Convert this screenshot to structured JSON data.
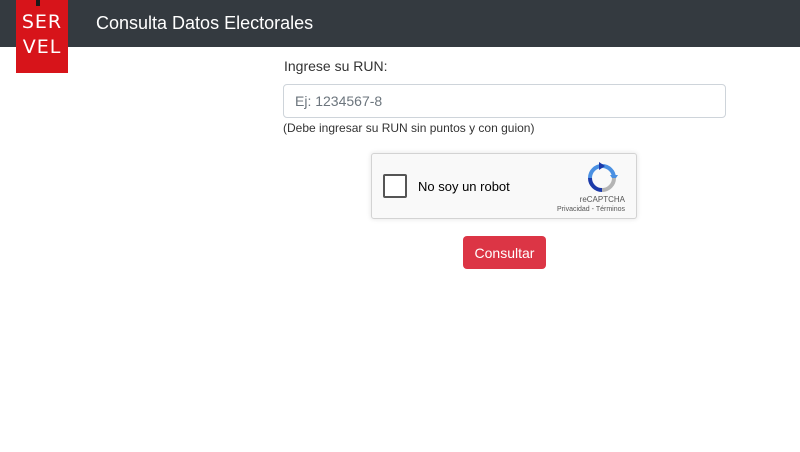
{
  "header": {
    "title": "Consulta Datos Electorales",
    "background_color": "#343a40"
  },
  "logo": {
    "line1": "SER",
    "line2": "VEL",
    "background_color": "#d7141a"
  },
  "form": {
    "run_label": "Ingrese su RUN:",
    "run_input": {
      "value": "",
      "placeholder": "Ej: 1234567-8"
    },
    "help_text": "(Debe ingresar su RUN sin puntos y con guion)",
    "submit_label": "Consultar",
    "submit_color": "#dc3545"
  },
  "captcha": {
    "label": "No soy un robot",
    "brand": "reCAPTCHA",
    "privacy_link": "Privacidad",
    "separator": " - ",
    "terms_link": "Términos",
    "icon": "recaptcha-icon"
  }
}
